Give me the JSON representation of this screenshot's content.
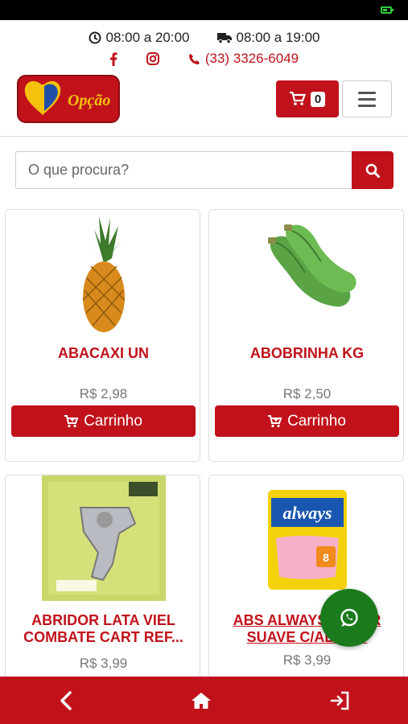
{
  "status_bar": {
    "battery_color": "#2ecc40"
  },
  "top_info": {
    "store_hours": "08:00 a 20:00",
    "delivery_hours": "08:00 a 19:00",
    "phone": "(33) 3326-6049",
    "icons": [
      "clock-icon",
      "truck-icon",
      "facebook-icon",
      "instagram-icon",
      "phone-icon"
    ]
  },
  "header": {
    "logo_text": "Opção",
    "cart_count": "0"
  },
  "search": {
    "placeholder": "O que procura?"
  },
  "products": [
    {
      "name": "ABACAXI UN",
      "price": "R$ 2,98",
      "button": "Carrinho"
    },
    {
      "name": "ABOBRINHA KG",
      "price": "R$ 2,50",
      "button": "Carrinho"
    },
    {
      "name": "ABRIDOR LATA VIEL COMBATE CART REF...",
      "price": "R$ 3,99"
    },
    {
      "name": "ABS ALWAYS SUPER SUAVE C/ABAS 8",
      "price": "R$ 3,99"
    }
  ],
  "colors": {
    "brand_red": "#c1121b",
    "whatsapp_green": "#1b7a1b"
  }
}
